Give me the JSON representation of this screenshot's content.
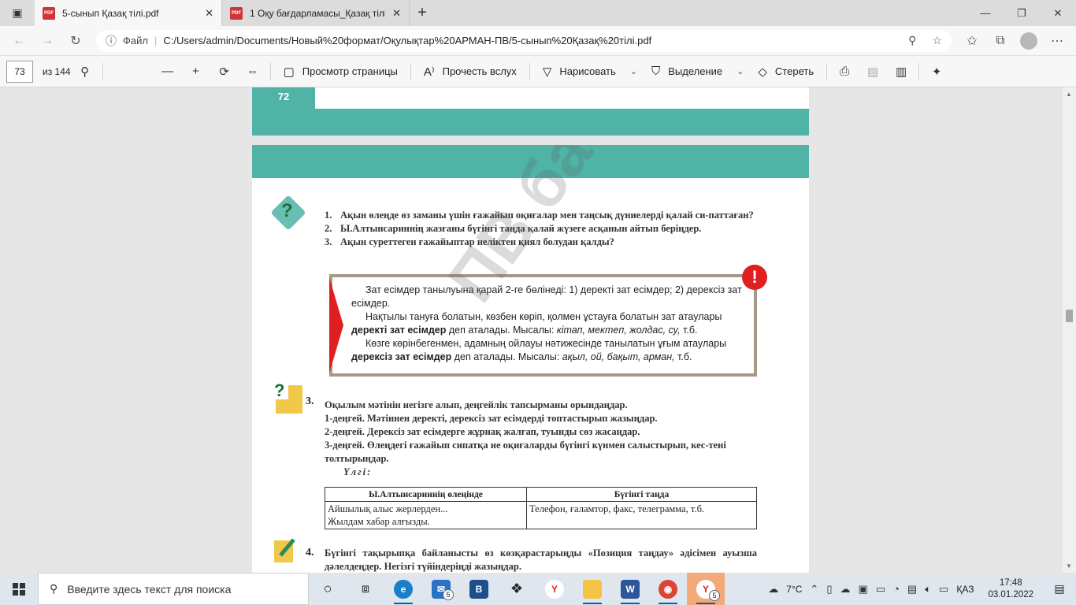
{
  "browser": {
    "tabs": [
      {
        "title": "5-сынып Қазақ тілі.pdf",
        "active": true
      },
      {
        "title": "1 Оқу бағдарламасы_Қазақ тілі",
        "active": false
      }
    ],
    "address": {
      "label": "Файл",
      "url": "C:/Users/admin/Documents/Новый%20формат/Оқулықтар%20АРМАН-ПВ/5-сынып%20Қазақ%20тілі.pdf"
    }
  },
  "pdf_toolbar": {
    "page_number": "73",
    "page_count": "из 144",
    "page_view": "Просмотр страницы",
    "read_aloud": "Прочесть вслух",
    "draw": "Нарисовать",
    "highlight": "Выделение",
    "erase": "Стереть"
  },
  "document": {
    "prev_page_number": "72",
    "questions": [
      {
        "n": "1.",
        "text": "Ақын өлеңде өз заманы үшін ғажайып оқиғалар мен таңсық дүниелерді қалай си-паттаған?"
      },
      {
        "n": "2.",
        "text": "Ы.Алтынсариннің жазғаны бүгінгі таңда қалай жүзеге асқанын айтып беріңдер."
      },
      {
        "n": "3.",
        "text": "Ақын суреттеген ғажайыптар неліктен қиял болудан қалды?"
      }
    ],
    "rule": {
      "p1": "Зат есімдер танылуына қарай 2-ге бөлінеді: 1) деректі зат есімдер; 2) дерексіз зат есімдер.",
      "p2_a": "Нақтылы тануға болатын, көзбен көріп, қолмен ұстауға болатын зат атаулары ",
      "p2_b": "деректі зат есімдер",
      "p2_c": " деп аталады. Мысалы: ",
      "p2_d": "кітап, мектеп, жолдас, су,",
      "p2_e": " т.б.",
      "p3_a": "Көзге көрінбегенмен, адамның ойлауы нәтижесінде танылатын ұғым атаулары ",
      "p3_b": "дерексіз зат есімдер",
      "p3_c": " деп аталады. Мысалы: ",
      "p3_d": "ақыл, ой, бақыт, арман,",
      "p3_e": " т.б."
    },
    "task3": {
      "number": "3.",
      "lines": [
        "Оқылым мәтінін негізге алып, деңгейлік тапсырманы орындаңдар.",
        "1-деңгей. Мәтіннен деректі, дерексіз зат есімдерді топтастырып жазыңдар.",
        "2-деңгей. Дерексіз зат есімдерге жұрнақ жалғап, туынды сөз жасаңдар.",
        "3-деңгей. Өлеңдегі ғажайып сипатқа ие оқиғаларды бүгінгі күнмен салыстырып, кес-тені толтырыңдар."
      ],
      "sample": "Үлгі:"
    },
    "table": {
      "headers": [
        "Ы.Алтынсариннің өлеңінде",
        "Бүгінгі таңда"
      ],
      "row": [
        "Айшылық алыс жерлерден...\nЖылдам хабар алғызды.",
        "Телефон, ғаламтор, факс, телеграмма, т.б."
      ]
    },
    "task4": {
      "number": "4.",
      "text": "Бүгінгі тақырыпқа байланысты өз көзқарастарыңды «Позиция таңдау» әдісімен ауызша дәлелдеңдер. Негізгі түйіндеріңді жазыңдар."
    },
    "watermark": "ПВ басасы",
    "colors": {
      "teal": "#4fb3a6",
      "warning_red": "#e02020",
      "rule_border": "#a49a86"
    }
  },
  "taskbar": {
    "search_placeholder": "Введите здесь текст для поиска",
    "mail_badge": "5",
    "yandex_badge": "5",
    "weather": "7°C",
    "lang": "ҚАЗ",
    "time": "17:48",
    "date": "03.01.2022"
  }
}
